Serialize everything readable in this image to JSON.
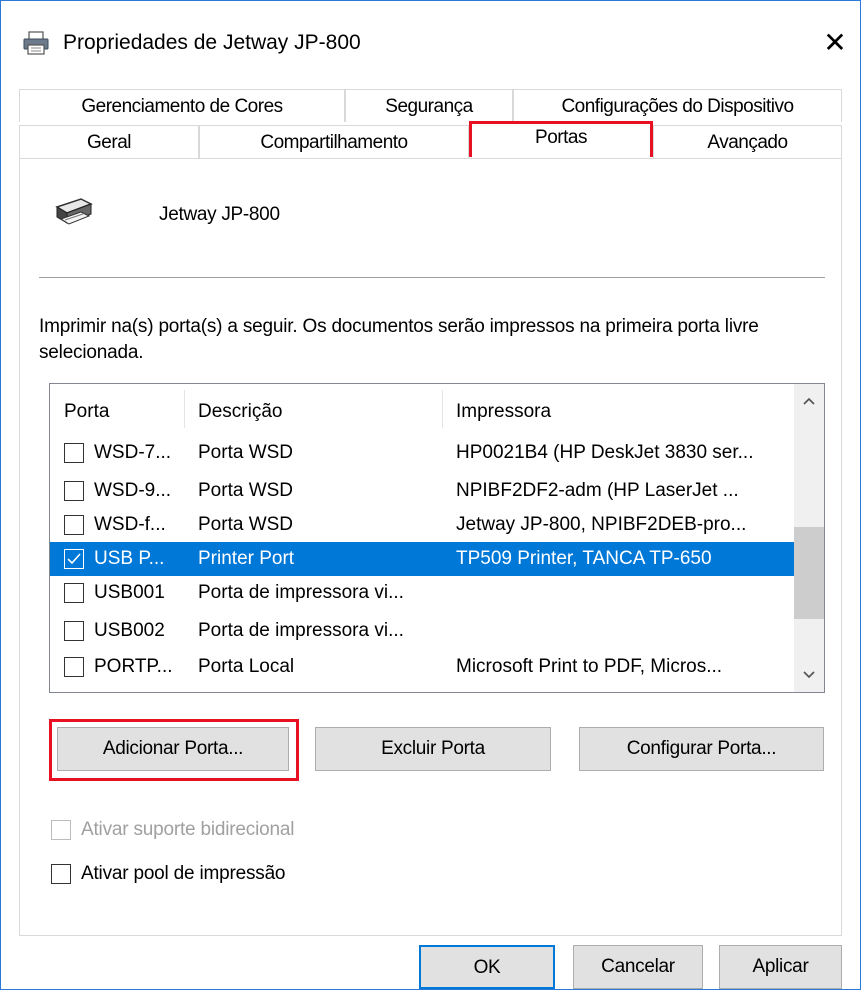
{
  "window": {
    "title": "Propriedades de Jetway JP-800",
    "close_glyph": "✕",
    "icon": "printer-icon"
  },
  "tabs_row1": [
    {
      "label": "Gerenciamento de Cores"
    },
    {
      "label": "Segurança"
    },
    {
      "label": "Configurações do Dispositivo"
    }
  ],
  "tabs_row2": [
    {
      "label": "Geral"
    },
    {
      "label": "Compartilhamento"
    },
    {
      "label": "Portas",
      "selected": true
    },
    {
      "label": "Avançado"
    }
  ],
  "printer": {
    "name": "Jetway JP-800",
    "icon": "printer-icon"
  },
  "description": "Imprimir na(s) porta(s) a seguir. Os documentos serão impressos na primeira porta livre selecionada.",
  "ports_table": {
    "headers": [
      "Porta",
      "Descrição",
      "Impressora"
    ],
    "rows": [
      {
        "checked": false,
        "port": "WSD-7...",
        "description": "Porta WSD",
        "printer": "HP0021B4 (HP DeskJet 3830 ser..."
      },
      {
        "checked": false,
        "port": "WSD-9...",
        "description": "Porta WSD",
        "printer": "NPIBF2DF2-adm (HP LaserJet ..."
      },
      {
        "checked": false,
        "port": "WSD-f...",
        "description": "Porta WSD",
        "printer": "Jetway JP-800, NPIBF2DEB-pro..."
      },
      {
        "checked": true,
        "selected": true,
        "port": "USB P...",
        "description": "Printer Port",
        "printer": "TP509 Printer, TANCA TP-650"
      },
      {
        "checked": false,
        "port": "USB001",
        "description": "Porta de impressora vi...",
        "printer": ""
      },
      {
        "checked": false,
        "port": "USB002",
        "description": "Porta de impressora vi...",
        "printer": ""
      },
      {
        "checked": false,
        "port": "PORTP...",
        "description": "Porta Local",
        "printer": "Microsoft Print to PDF, Micros..."
      }
    ],
    "scroll_up_glyph": "⌃",
    "scroll_down_glyph": "⌄"
  },
  "port_buttons": {
    "add": "Adicionar Porta...",
    "delete": "Excluir Porta",
    "configure": "Configurar Porta..."
  },
  "options": {
    "bidirectional": {
      "label": "Ativar suporte bidirecional",
      "checked": false,
      "disabled": true
    },
    "pooling": {
      "label": "Ativar pool de impressão",
      "checked": false,
      "disabled": false
    }
  },
  "dialog_buttons": {
    "ok": "OK",
    "cancel": "Cancelar",
    "apply": "Aplicar"
  },
  "colors": {
    "selection": "#0078d7",
    "highlight_box": "#e81123",
    "window_border": "#2b79d7"
  }
}
